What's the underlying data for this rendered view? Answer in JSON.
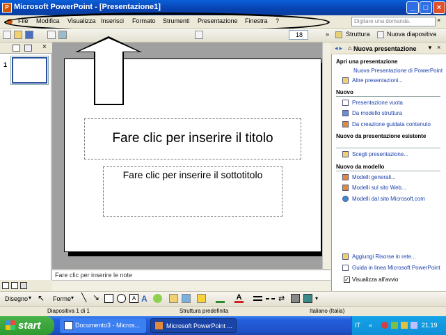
{
  "window": {
    "title": "Microsoft PowerPoint - [Presentazione1]",
    "minimize": "_",
    "maximize": "□",
    "close": "×"
  },
  "menu": {
    "items": [
      "File",
      "Modifica",
      "Visualizza",
      "Inserisci",
      "Formato",
      "Strumenti",
      "Presentazione",
      "Finestra",
      "?"
    ],
    "help_placeholder": "Digitare una domanda.",
    "help_close": "×"
  },
  "toolbar": {
    "font_size": "18",
    "struttura": "Struttura",
    "nuova_diapositiva": "Nuova diapositiva"
  },
  "slide": {
    "number": "1",
    "title_placeholder": "Fare clic per inserire il titolo",
    "subtitle_placeholder": "Fare clic per inserire il sottotitolo"
  },
  "notes": {
    "placeholder": "Fare clic per inserire le note"
  },
  "task_pane": {
    "title": "Nuova presentazione",
    "section_open": "Apri una presentazione",
    "open_links": [
      "Nuova Presentazione di PowerPoint",
      "Altre presentazioni..."
    ],
    "section_new": "Nuovo",
    "new_links": [
      "Presentazione vuota",
      "Da modello struttura",
      "Da creazione guidata contenuto"
    ],
    "section_existing": "Nuovo da presentazione esistente",
    "existing_links": [
      "Scegli presentazione..."
    ],
    "section_template": "Nuovo da modello",
    "template_links": [
      "Modelli generali...",
      "Modelli sul sito Web...",
      "Modelli dal sito Microsoft.com"
    ],
    "bottom_links": [
      "Aggiungi Risorse in rete...",
      "Guida in linea Microsoft PowerPoint"
    ],
    "startup_checkbox": "Visualizza all'avvio"
  },
  "drawing": {
    "disegno": "Disegno",
    "forme": "Forme"
  },
  "status": {
    "slide": "Diapositiva 1 di 1",
    "design": "Struttura predefinita",
    "language": "Italiano (Italia)"
  },
  "taskbar": {
    "start": "start",
    "buttons": [
      "Documento3 - Micros...",
      "Microsoft PowerPoint ..."
    ],
    "lang": "IT",
    "clock": "21.19"
  }
}
